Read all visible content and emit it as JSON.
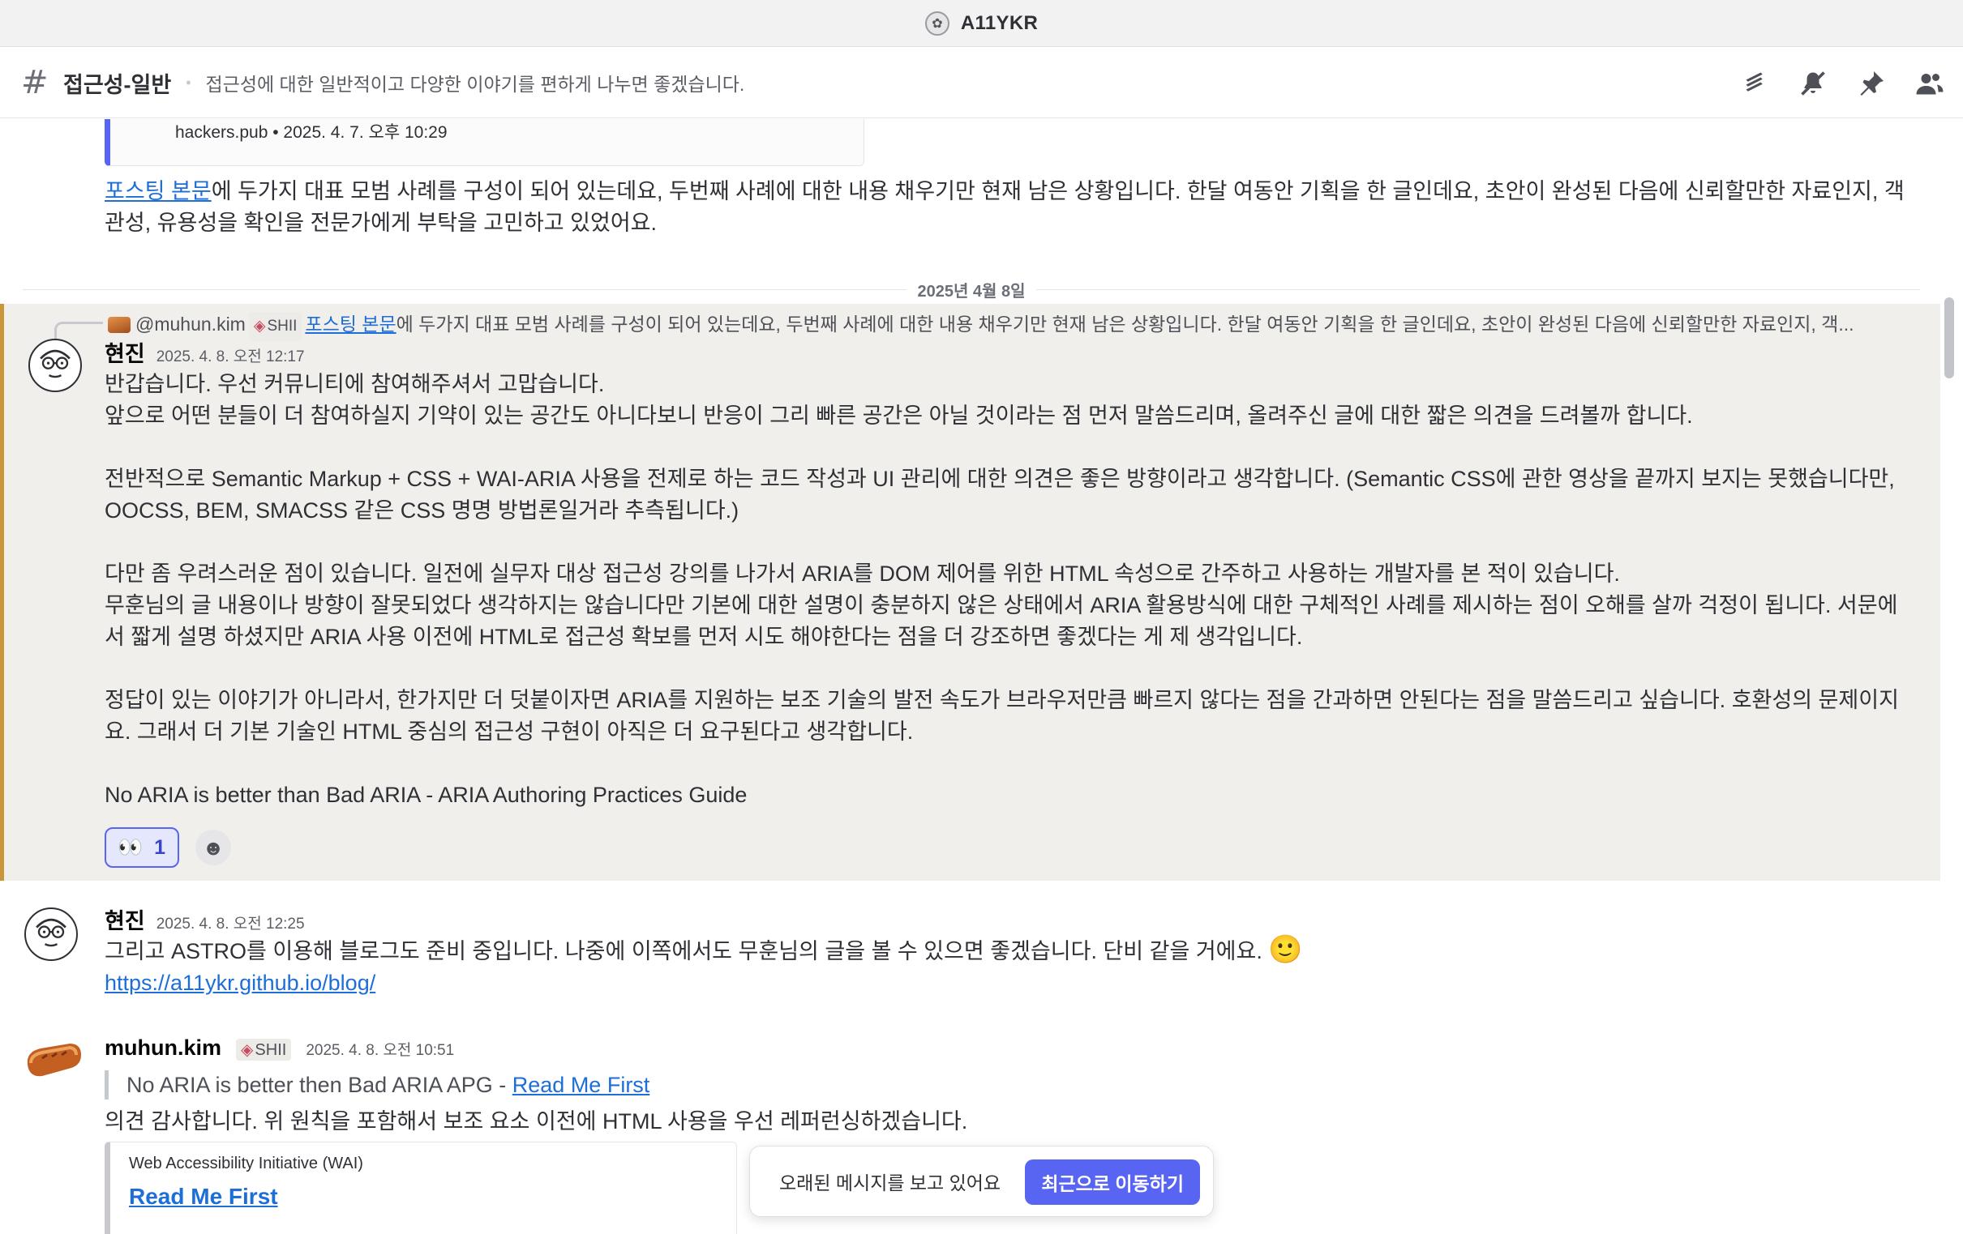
{
  "window": {
    "title": "A11YKR"
  },
  "channel": {
    "name": "접근성-일반",
    "topic": "접근성에 대한 일반적이고 다양한 이야기를 편하게 나누면 좋겠습니다.",
    "icons": [
      "threads-icon",
      "mute-notifications-icon",
      "pin-icon",
      "member-list-icon"
    ]
  },
  "top_embed": {
    "meta": "hackers.pub • 2025. 4. 7. 오후 10:29"
  },
  "top_message": {
    "link_text": "포스팅 본문",
    "text": "에 두가지 대표 모범 사례를 구성이 되어 있는데요, 두번째 사례에 대한 내용 채우기만 현재 남은 상황입니다. 한달 여동안 기획을 한 글인데요, 초안이 완성된 다음에 신뢰할만한 자료인지, 객관성, 유용성을 확인을 전문가에게 부탁을 고민하고 있었어요."
  },
  "date_divider": "2025년 4월 8일",
  "messages": [
    {
      "reply": {
        "author": "@muhun.kim",
        "role": "SHII",
        "link_text": "포스팅 본문",
        "text": "에 두가지 대표 모범 사례를 구성이 되어 있는데요, 두번째 사례에 대한 내용 채우기만 현재 남은 상황입니다. 한달 여동안 기획을 한 글인데요, 초안이 완성된 다음에 신뢰할만한 자료인지, 객..."
      },
      "author": "현진",
      "timestamp": "2025. 4. 8. 오전 12:17",
      "lines": [
        "반갑습니다. 우선 커뮤니티에 참여해주셔서 고맙습니다.",
        "앞으로 어떤 분들이 더 참여하실지 기약이 있는 공간도 아니다보니 반응이 그리 빠른 공간은 아닐 것이라는 점 먼저 말씀드리며, 올려주신 글에 대한 짧은 의견을 드려볼까 합니다.",
        "",
        "전반적으로 Semantic Markup + CSS + WAI-ARIA 사용을 전제로 하는 코드 작성과 UI 관리에 대한 의견은 좋은 방향이라고 생각합니다. (Semantic CSS에 관한 영상을 끝까지 보지는 못했습니다만, OOCSS,  BEM, SMACSS 같은 CSS 명명 방법론일거라 추측됩니다.)",
        "",
        "다만 좀 우려스러운 점이 있습니다. 일전에 실무자 대상 접근성 강의를 나가서 ARIA를 DOM 제어를 위한 HTML 속성으로 간주하고 사용하는 개발자를 본 적이 있습니다.",
        "무훈님의 글 내용이나 방향이 잘못되었다 생각하지는 않습니다만 기본에 대한 설명이 충분하지 않은 상태에서 ARIA 활용방식에 대한 구체적인 사례를 제시하는 점이 오해를 살까 걱정이 됩니다. 서문에서 짧게 설명 하셨지만 ARIA 사용 이전에 HTML로 접근성 확보를 먼저 시도 해야한다는 점을 더 강조하면 좋겠다는 게 제 생각입니다.",
        "",
        "정답이 있는 이야기가 아니라서, 한가지만 더 덧붙이자면 ARIA를 지원하는 보조 기술의 발전 속도가 브라우저만큼 빠르지 않다는 점을 간과하면 안된다는 점을 말씀드리고 싶습니다. 호환성의 문제이지요. 그래서 더 기본 기술인 HTML 중심의 접근성 구현이 아직은 더 요구된다고 생각합니다.",
        "",
        "No ARIA is better than Bad ARIA - ARIA Authoring Practices Guide"
      ],
      "reaction": {
        "emoji": "👀",
        "count": "1"
      }
    },
    {
      "author": "현진",
      "timestamp": "2025. 4. 8. 오전 12:25",
      "text": "그리고 ASTRO를 이용해 블로그도 준비 중입니다. 나중에 이쪽에서도 무훈님의 글을 볼 수 있으면 좋겠습니다. 단비 같을 거에요.",
      "emoji": "🙂",
      "link": "https://a11ykr.github.io/blog/"
    },
    {
      "author": "muhun.kim",
      "role": "SHII",
      "timestamp": "2025. 4. 8. 오전 10:51",
      "quote_text": "No ARIA is better then Bad ARIA APG - ",
      "quote_link": "Read Me First",
      "text": "의견 감사합니다. 위 원칙을 포함해서 보조 요소 이전에 HTML 사용을 우선 레퍼런싱하겠습니다.",
      "embed": {
        "provider": "Web Accessibility Initiative (WAI)",
        "title": "Read Me First"
      }
    }
  ],
  "jump_toast": {
    "text": "오래된 메시지를 보고 있어요",
    "button": "최근으로 이동하기"
  },
  "colors": {
    "accent": "#5865f2",
    "link": "#1e6ed8",
    "highlight_bg": "#f1efeb",
    "highlight_bar": "#c9963a"
  }
}
